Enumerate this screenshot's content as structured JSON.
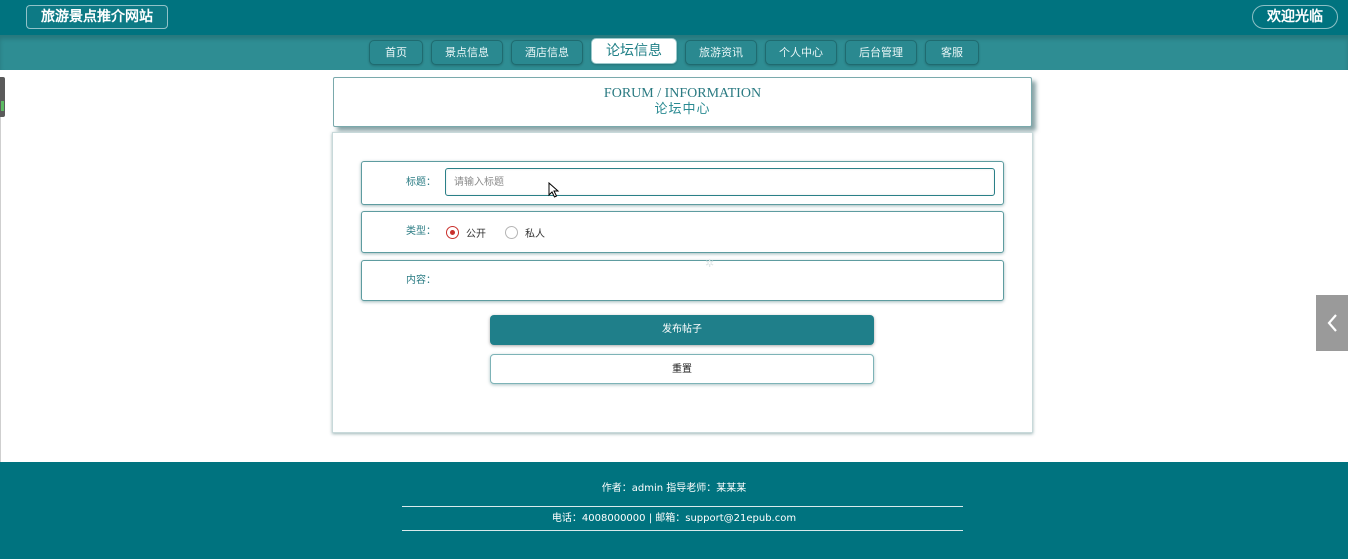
{
  "header": {
    "site_title": "旅游景点推介网站",
    "welcome": "欢迎光临"
  },
  "nav": {
    "items": [
      {
        "label": "首页",
        "active": false
      },
      {
        "label": "景点信息",
        "active": false
      },
      {
        "label": "酒店信息",
        "active": false
      },
      {
        "label": "论坛信息",
        "active": true
      },
      {
        "label": "旅游资讯",
        "active": false
      },
      {
        "label": "个人中心",
        "active": false
      },
      {
        "label": "后台管理",
        "active": false
      },
      {
        "label": "客服",
        "active": false
      }
    ]
  },
  "section": {
    "title_en": "FORUM / INFORMATION",
    "title_cn": "论坛中心"
  },
  "form": {
    "title_label": "标题：",
    "title_placeholder": "请输入标题",
    "title_value": "",
    "type_label": "类型：",
    "type_options": [
      {
        "label": "公开",
        "checked": true
      },
      {
        "label": "私人",
        "checked": false
      }
    ],
    "content_label": "内容：",
    "submit_label": "发布帖子",
    "reset_label": "重置"
  },
  "footer": {
    "line1": "作者：admin 指导老师：某某某",
    "line2": "电话：4008000000 | 邮箱：support@21epub.com"
  },
  "icons": {
    "side_toggle": "chevron-left-icon",
    "spinner": "loading-icon",
    "cursor": "mouse-pointer-icon"
  },
  "colors": {
    "primary": "#00737f",
    "nav_bg": "#2e8d93",
    "button": "#1f7f8a",
    "radio_checked": "#c9302c"
  }
}
